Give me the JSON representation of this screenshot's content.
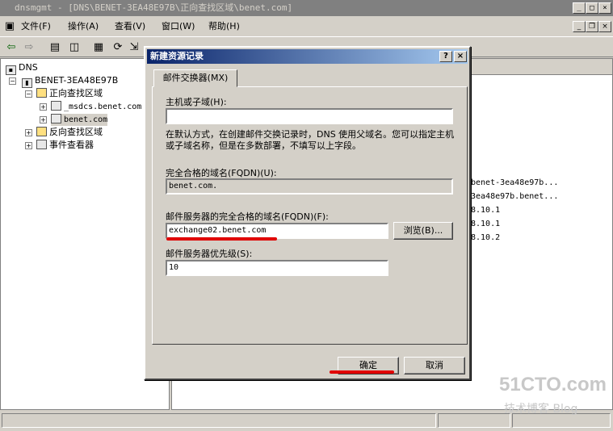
{
  "window": {
    "title": "dnsmgmt - [DNS\\BENET-3EA48E97B\\正向查找区域\\benet.com]",
    "min": "_",
    "max": "□",
    "close": "×"
  },
  "menu": [
    "文件(F)",
    "操作(A)",
    "查看(V)",
    "窗口(W)",
    "帮助(H)"
  ],
  "tree": {
    "root": "DNS",
    "server": "BENET-3EA48E97B",
    "forward_zone": "正向查找区域",
    "msdcs": "_msdcs.benet.com",
    "benet": "benet.com",
    "reverse_zone": "反向查找区域",
    "event_viewer": "事件查看器"
  },
  "right_pane": {
    "rows": [
      "benet-3ea48e97b...",
      "3ea48e97b.benet...",
      "8.10.1",
      "8.10.1",
      "8.10.2"
    ]
  },
  "dialog": {
    "title": "新建资源记录",
    "help": "?",
    "close": "×",
    "tab": "邮件交换器(MX)",
    "host_label": "主机或子域(H):",
    "host_value": "",
    "description": "在默认方式，在创建邮件交换记录时，DNS 使用父域名。您可以指定主机或子域名称，但是在多数部署，不填写以上字段。",
    "fqdn_label": "完全合格的域名(FQDN)(U):",
    "fqdn_value": "benet.com.",
    "server_label": "邮件服务器的完全合格的域名(FQDN)(F):",
    "server_value": "exchange02.benet.com",
    "browse": "浏览(B)...",
    "priority_label": "邮件服务器优先级(S):",
    "priority_value": "10",
    "ok": "确定",
    "cancel": "取消"
  },
  "watermark": {
    "line1": "51CTO.com",
    "line2": "技术博客 Blog"
  },
  "colors": {
    "title_active": "#0a246a",
    "highlight": "#e00000"
  }
}
